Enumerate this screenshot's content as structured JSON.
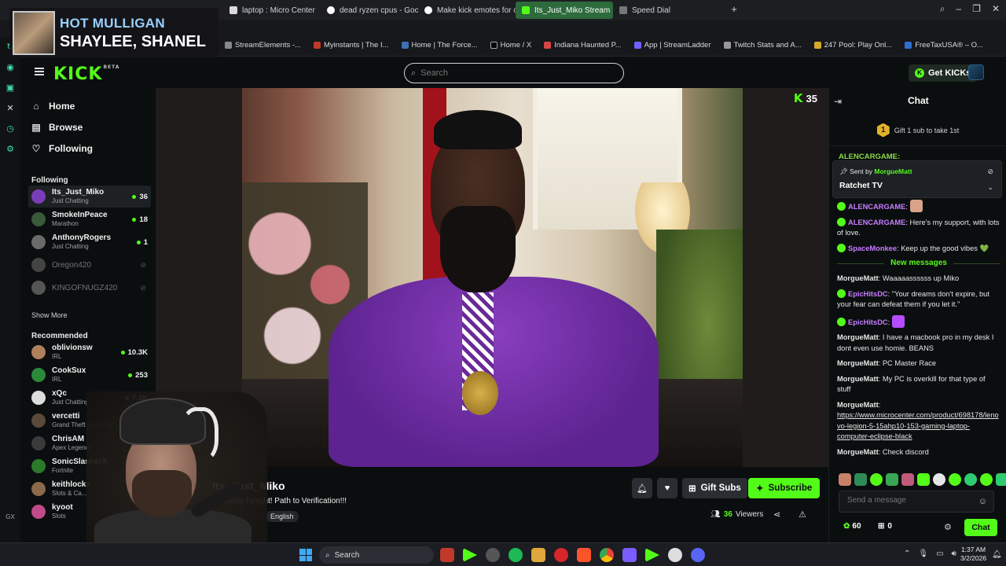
{
  "browser": {
    "tabs": [
      {
        "label": "laptop : Micro Center",
        "active": false
      },
      {
        "label": "dead ryzen cpus - Google",
        "active": false
      },
      {
        "label": "Make kick emotes for chat",
        "active": false
      },
      {
        "label": "Its_Just_Miko Stream",
        "active": true
      },
      {
        "label": "Speed Dial",
        "active": false
      }
    ],
    "bookmarks": [
      "StreamElements -...",
      "Myinstants | The I...",
      "Home | The Force...",
      "Home / X",
      "Indiana Haunted P...",
      "App | StreamLadder",
      "Twitch Stats and A...",
      "247 Pool: Play Onl...",
      "FreeTaxUSA® – O..."
    ]
  },
  "overlay": {
    "title": "HOT MULLIGAN",
    "names": "SHAYLEE, SHANEL"
  },
  "kick": {
    "logo": "KICK",
    "logo_badge": "BETA",
    "search_placeholder": "Search",
    "get_kicks": "Get KICKs"
  },
  "sidebar": {
    "nav": [
      {
        "label": "Home",
        "icon": "home-icon"
      },
      {
        "label": "Browse",
        "icon": "browse-icon"
      },
      {
        "label": "Following",
        "icon": "heart-icon"
      }
    ],
    "following_heading": "Following",
    "following": [
      {
        "name": "Its_Just_Miko",
        "category": "Just Chatting",
        "viewers": "36",
        "live": true,
        "active": true,
        "color": "#7a3db8"
      },
      {
        "name": "SmokeInPeace",
        "category": "Marathon",
        "viewers": "18",
        "live": true,
        "color": "#3a5a3a"
      },
      {
        "name": "AnthonyRogers",
        "category": "Just Chatting",
        "viewers": "1",
        "live": true,
        "color": "#6a6a6a"
      },
      {
        "name": "Oregon420",
        "category": "",
        "viewers": "",
        "live": false,
        "color": "#444"
      },
      {
        "name": "KINGOFNUGZ420",
        "category": "",
        "viewers": "",
        "live": false,
        "color": "#555"
      }
    ],
    "show_more": "Show More",
    "recommended_heading": "Recommended",
    "recommended": [
      {
        "name": "oblivionsw",
        "category": "IRL",
        "viewers": "10.3K",
        "color": "#b0805a"
      },
      {
        "name": "CookSux",
        "category": "IRL",
        "viewers": "253",
        "color": "#2a8a3a"
      },
      {
        "name": "xQc",
        "category": "Just Chatting",
        "viewers": "7.2K",
        "color": "#dddddd"
      },
      {
        "name": "vercetti",
        "category": "Grand Theft Auto V (G...",
        "viewers": "",
        "color": "#5a4a3a"
      },
      {
        "name": "ChrisAM",
        "category": "Apex Legends",
        "viewers": "",
        "color": "#3a3a3a"
      },
      {
        "name": "SonicSlasherX",
        "category": "Fortnite",
        "viewers": "",
        "color": "#2a7a2a"
      },
      {
        "name": "keithlocks",
        "category": "Slots & Ca...",
        "viewers": "",
        "color": "#8a6a4a"
      },
      {
        "name": "kyoot",
        "category": "Slots",
        "viewers": "",
        "color": "#c04a8a"
      }
    ]
  },
  "stream": {
    "viewer_badge": "35",
    "channel_name": "Its_Just_Miko",
    "title": "Relaxing Tonight! Path to Verification!!!",
    "language": "English",
    "gift_subs": "Gift Subs",
    "subscribe": "Subscribe",
    "viewers_count": "36",
    "viewers_label": "Viewers"
  },
  "chat": {
    "title": "Chat",
    "gift_banner_number": "1",
    "gift_banner_text": "Gift 1 sub to take 1st",
    "top_partial_user": "ALENCARGAME:",
    "pinned": {
      "sent_by_label": "Sent by",
      "sent_by_user": "MorgueMatt",
      "text": "Ratchet TV"
    },
    "messages_before": [
      {
        "user": "ALENCARGAME",
        "color": "#c77dff",
        "badge": true,
        "text": "",
        "emote": "#d9a28a"
      },
      {
        "user": "ALENCARGAME",
        "color": "#c77dff",
        "badge": true,
        "text": "Here's my support, with lots of love."
      },
      {
        "user": "SpaceMonkee",
        "color": "#c77dff",
        "badge": true,
        "text": "Keep up the good vibes 💚"
      }
    ],
    "new_messages_label": "New messages",
    "messages_after": [
      {
        "user": "MorgueMatt",
        "color": "#e6e6e6",
        "badge": false,
        "text": "Waaaaassssss up Miko"
      },
      {
        "user": "EpicHitsDC",
        "color": "#c77dff",
        "badge": true,
        "text": "\"Your dreams don't expire, but your fear can defeat them if you let it.\""
      },
      {
        "user": "EpicHitsDC",
        "color": "#c77dff",
        "badge": true,
        "text": "",
        "emote": "#b54cff"
      },
      {
        "user": "MorgueMatt",
        "color": "#e6e6e6",
        "badge": false,
        "text": "I have a macbook pro in my desk I dont even use homie. BEANS"
      },
      {
        "user": "MorgueMatt",
        "color": "#e6e6e6",
        "badge": false,
        "text": "PC Master Race"
      },
      {
        "user": "MorgueMatt",
        "color": "#e6e6e6",
        "badge": false,
        "text": "My PC is overkill for that type of stuff"
      },
      {
        "user": "MorgueMatt",
        "color": "#e6e6e6",
        "badge": false,
        "text": "",
        "link": "https://www.microcenter.com/product/698178/lenovo-legion-5-15ahp10-153-gaming-laptop-computer-eclipse-black"
      },
      {
        "user": "MorgueMatt",
        "color": "#e6e6e6",
        "badge": false,
        "text": "Check discord"
      }
    ],
    "input_placeholder": "Send a message",
    "points": "60",
    "other_count": "0",
    "chat_button": "Chat"
  },
  "taskbar": {
    "search_label": "Search",
    "time": "1:37 AM",
    "date": "3/2/2026"
  },
  "colors": {
    "kick_green": "#53fc18",
    "background": "#0b0e0f",
    "panel": "#1e2124"
  }
}
